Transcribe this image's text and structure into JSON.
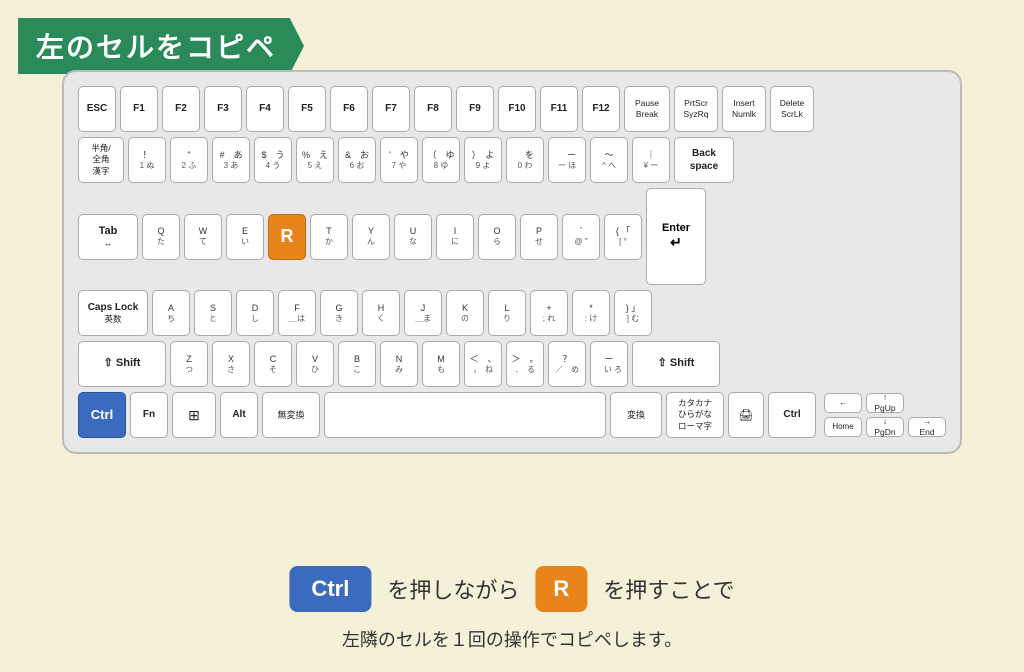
{
  "title": "左のセルをコピペ",
  "keyboard": {
    "row1": [
      "ESC",
      "F1",
      "F2",
      "F3",
      "F4",
      "F5",
      "F6",
      "F7",
      "F8",
      "F9",
      "F10",
      "F11",
      "F12",
      "Pause\nBreak",
      "PrtScr\nSyzRq",
      "Insert\nNumlk",
      "Delete\nScrLk"
    ],
    "backspace": "Back\nspace",
    "tab": "Tab",
    "capslock": "Caps Lock\n英数",
    "shift_l": "⇧ Shift",
    "shift_r": "⇧ Shift",
    "ctrl_l": "Ctrl",
    "fn": "Fn",
    "win": "⊞",
    "alt": "Alt",
    "muhenkan": "無変換",
    "henkan": "変換",
    "katakana": "カタカナ\nひらがな\nローマ字",
    "ctrl_r": "Ctrl",
    "enter": "Enter",
    "home": "Home",
    "pgup": "↑\nPgUp",
    "pgdn": "↓\nPgDn",
    "end": "→\nEnd",
    "left": "←"
  },
  "instruction": {
    "ctrl_label": "Ctrl",
    "text1": "を押しながら",
    "r_label": "R",
    "text2": "を押すことで",
    "subtext": "左隣のセルを１回の操作でコピペします。"
  }
}
